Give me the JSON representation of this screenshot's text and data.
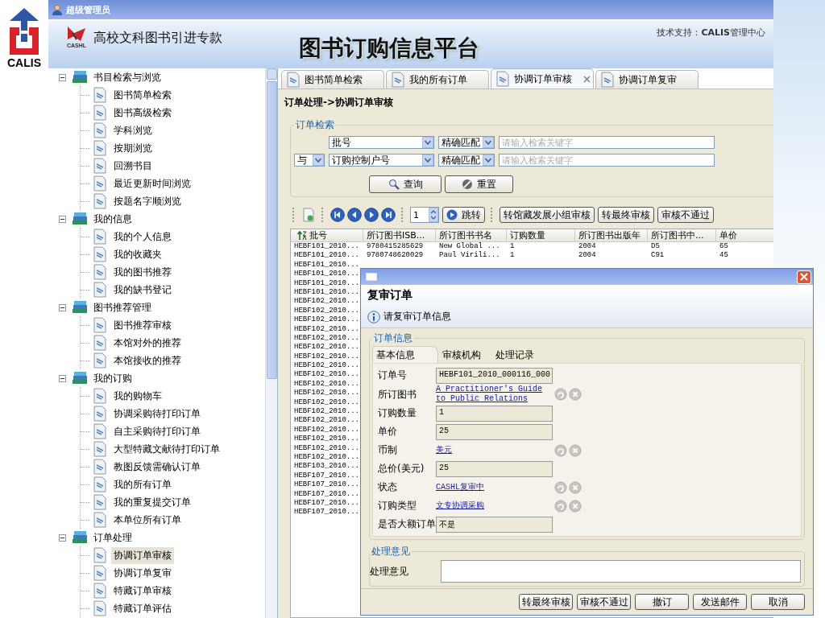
{
  "page": {
    "brand": "CALIS"
  },
  "window": {
    "title": "超级管理员"
  },
  "header": {
    "logo_caption": "CASHL",
    "program": "高校文科图书引进专款",
    "title": "图书订购信息平台",
    "support": "技术支持：**CALIS**管理中心"
  },
  "sidebar": {
    "groups": [
      {
        "label": "书目检索与浏览",
        "expanded": true,
        "children": [
          {
            "label": "图书简单检索",
            "selected": false
          },
          {
            "label": "图书高级检索",
            "selected": false
          },
          {
            "label": "学科浏览",
            "selected": false
          },
          {
            "label": "按期浏览",
            "selected": false
          },
          {
            "label": "回溯书目",
            "selected": false
          },
          {
            "label": "最近更新时间浏览",
            "selected": false
          },
          {
            "label": "按题名字顺浏览",
            "selected": false
          }
        ]
      },
      {
        "label": "我的信息",
        "expanded": true,
        "children": [
          {
            "label": "我的个人信息",
            "selected": false
          },
          {
            "label": "我的收藏夹",
            "selected": false
          },
          {
            "label": "我的图书推荐",
            "selected": false
          },
          {
            "label": "我的缺书登记",
            "selected": false
          }
        ]
      },
      {
        "label": "图书推荐管理",
        "expanded": true,
        "children": [
          {
            "label": "图书推荐审核",
            "selected": false
          },
          {
            "label": "本馆对外的推荐",
            "selected": false
          },
          {
            "label": "本馆接收的推荐",
            "selected": false
          }
        ]
      },
      {
        "label": "我的订购",
        "expanded": true,
        "children": [
          {
            "label": "我的购物车",
            "selected": false
          },
          {
            "label": "协调采购待打印订单",
            "selected": false
          },
          {
            "label": "自主采购待打印订单",
            "selected": false
          },
          {
            "label": "大型特藏文献待打印订单",
            "selected": false
          },
          {
            "label": "教图反馈需确认订单",
            "selected": false
          },
          {
            "label": "我的所有订单",
            "selected": false
          },
          {
            "label": "我的重复提交订单",
            "selected": false
          },
          {
            "label": "本单位所有订单",
            "selected": false
          }
        ]
      },
      {
        "label": "订单处理",
        "expanded": true,
        "children": [
          {
            "label": "协调订单审核",
            "selected": true
          },
          {
            "label": "协调订单复审",
            "selected": false
          },
          {
            "label": "特藏订单审核",
            "selected": false
          },
          {
            "label": "特藏订单评估",
            "selected": false
          }
        ]
      }
    ]
  },
  "tabs": [
    {
      "label": "图书简单检索",
      "selected": false,
      "closable": false
    },
    {
      "label": "我的所有订单",
      "selected": false,
      "closable": false
    },
    {
      "label": "协调订单审核",
      "selected": true,
      "closable": true
    },
    {
      "label": "协调订单复审",
      "selected": false,
      "closable": false
    }
  ],
  "breadcrumb": "订单处理->协调订单审核",
  "search": {
    "legend": "订单检索",
    "rows": [
      {
        "field": "批号",
        "match": "精确匹配",
        "placeholder": "请输入检索关键字"
      },
      {
        "operator": "与",
        "field": "订购控制户号",
        "match": "精确匹配",
        "placeholder": "请输入检索关键字"
      }
    ],
    "buttons": [
      {
        "label": "查询",
        "kind": "search"
      },
      {
        "label": "重置",
        "kind": "reset"
      }
    ]
  },
  "toolbar": {
    "page": "1",
    "jump": "跳转",
    "actions": [
      "转馆藏发展小组审核",
      "转最终审核",
      "审核不通过"
    ]
  },
  "table": {
    "columns": [
      {
        "label": "批号",
        "sorted": true
      },
      {
        "label": "所订图书ISB...",
        "sorted": false
      },
      {
        "label": "所订图书书名",
        "sorted": false
      },
      {
        "label": "订购数量",
        "sorted": false
      },
      {
        "label": "所订图书出版年",
        "sorted": false
      },
      {
        "label": "所订图书中...",
        "sorted": false
      },
      {
        "label": "单价",
        "sorted": false
      }
    ],
    "rows": [
      {
        "cells": [
          "HEBF101_2010...",
          "9780415285629",
          "New Global ...",
          "1",
          "2004",
          "D5",
          "65"
        ]
      },
      {
        "cells": [
          "HEBF101_2010...",
          "9780748620029",
          "Paul Virili...",
          "1",
          "2004",
          "C91",
          "45"
        ]
      },
      {
        "cells": [
          "HEBF101_2010..."
        ]
      },
      {
        "cells": [
          "HEBF101_2010..."
        ]
      },
      {
        "cells": [
          "HEBF101_2010..."
        ]
      },
      {
        "cells": [
          "HEBF101_2010..."
        ]
      },
      {
        "cells": [
          "HEBF102_2010..."
        ]
      },
      {
        "cells": [
          "HEBF102_2010..."
        ]
      },
      {
        "cells": [
          "HEBF102_2010..."
        ]
      },
      {
        "cells": [
          "HEBF102_2010..."
        ]
      },
      {
        "cells": [
          "HEBF102_2010..."
        ]
      },
      {
        "cells": [
          "HEBF102_2010..."
        ]
      },
      {
        "cells": [
          "HEBF102_2010..."
        ]
      },
      {
        "cells": [
          "HEBF102_2010..."
        ]
      },
      {
        "cells": [
          "HEBF102_2010..."
        ]
      },
      {
        "cells": [
          "HEBF102_2010..."
        ]
      },
      {
        "cells": [
          "HEBF102_2010..."
        ]
      },
      {
        "cells": [
          "HEBF102_2010..."
        ]
      },
      {
        "cells": [
          "HEBF102_2010..."
        ]
      },
      {
        "cells": [
          "HEBF102_2010..."
        ]
      },
      {
        "cells": [
          "HEBF102_2010..."
        ]
      },
      {
        "cells": [
          "HEBF102_2010..."
        ]
      },
      {
        "cells": [
          "HEBF102_2010..."
        ]
      },
      {
        "cells": [
          "HEBF102_2010..."
        ]
      },
      {
        "cells": [
          "HEBF103_2010..."
        ]
      },
      {
        "cells": [
          "HEBF107_2010..."
        ]
      },
      {
        "cells": [
          "HEBF107_2010..."
        ]
      },
      {
        "cells": [
          "HEBF107_2010..."
        ]
      },
      {
        "cells": [
          "HEBF107_2010..."
        ]
      },
      {
        "cells": [
          "HEBF107_2010..."
        ]
      }
    ]
  },
  "dialog": {
    "title": "复审订单",
    "message": "请复审订单信息",
    "legend": "订单信息",
    "tabs": [
      {
        "label": "基本信息",
        "selected": true
      },
      {
        "label": "审核机构",
        "selected": false
      },
      {
        "label": "处理记录",
        "selected": false
      }
    ],
    "fields": [
      {
        "label": "订单号",
        "kind": "text",
        "value": "HEBF101_2010_000116_000"
      },
      {
        "label": "所订图书",
        "kind": "link",
        "value": "A Practitioner's Guide to Public Relations",
        "actions": true
      },
      {
        "label": "订购数量",
        "kind": "text",
        "value": "1"
      },
      {
        "label": "单价",
        "kind": "text",
        "value": "25"
      },
      {
        "label": "币制",
        "kind": "link",
        "value": "美元",
        "actions": true
      },
      {
        "label": "总价(美元)",
        "kind": "text",
        "value": "25"
      },
      {
        "label": "状态",
        "kind": "link",
        "value": "CASHL复审中",
        "actions": true
      },
      {
        "label": "订购类型",
        "kind": "link",
        "value": "文专协调采购",
        "actions": true
      },
      {
        "label": "是否大额订单",
        "kind": "text",
        "value": "不是"
      }
    ],
    "comment": {
      "legend": "处理意见",
      "label": "处理意见"
    },
    "buttons": [
      "转最终审核",
      "审核不通过",
      "撤订",
      "发送邮件",
      "取消"
    ]
  }
}
